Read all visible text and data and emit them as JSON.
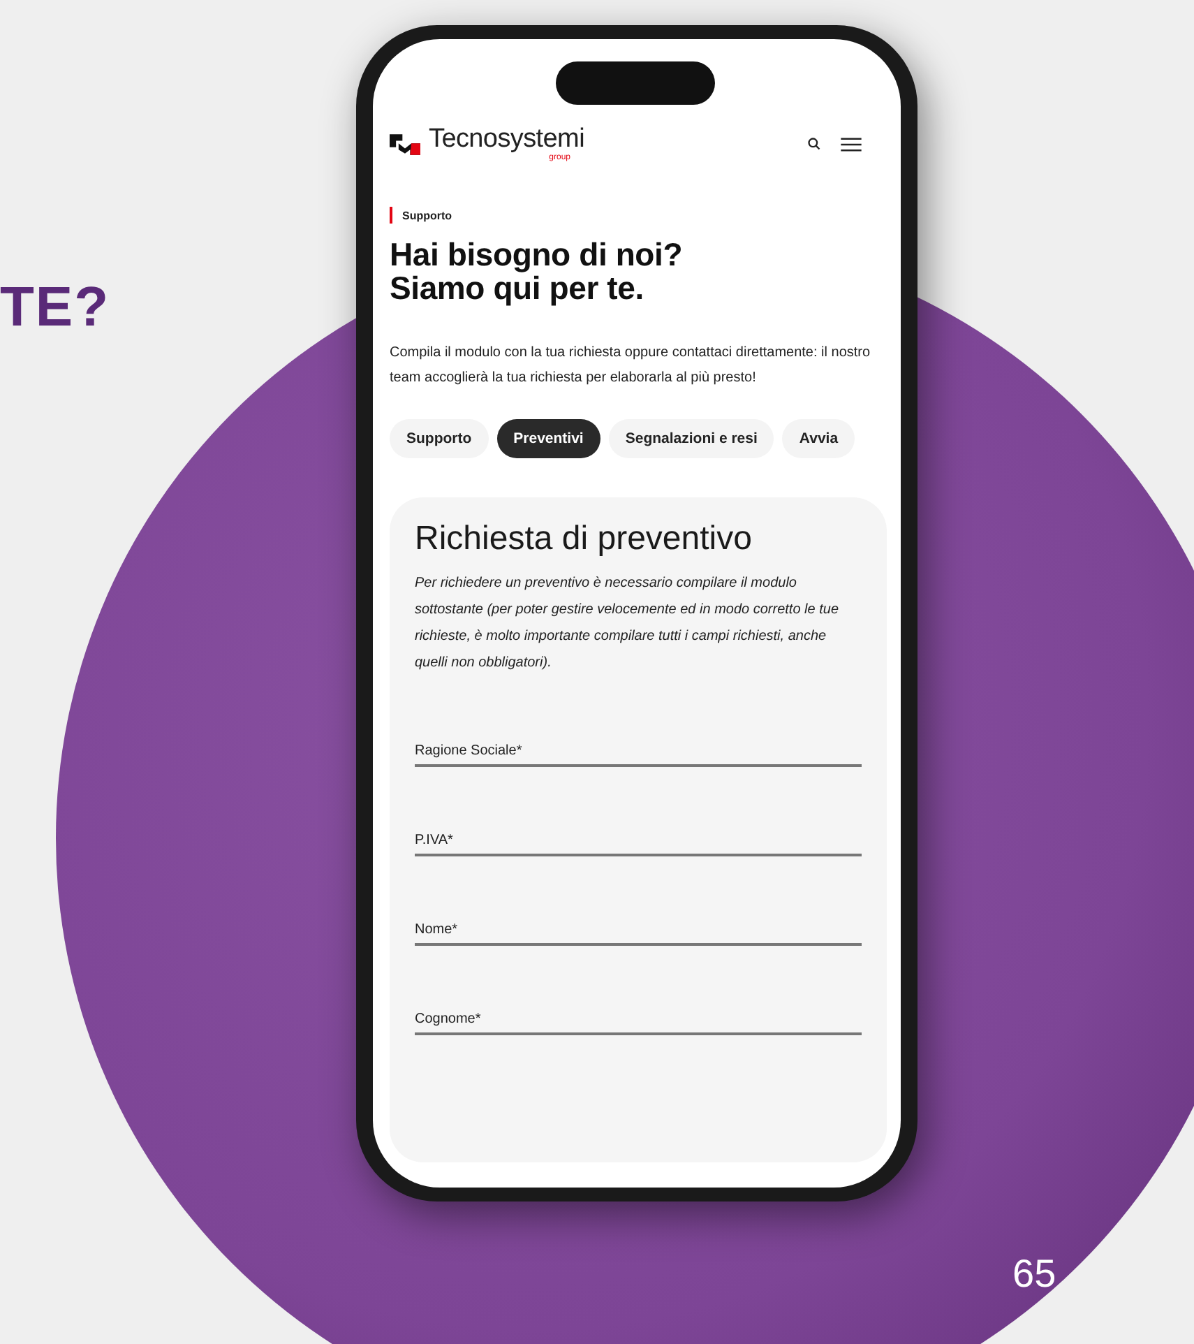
{
  "page": {
    "heading_fragment": "TE?",
    "page_number": "65"
  },
  "site_header": {
    "logo_text": "Tecnosystemi",
    "logo_subtext": "group"
  },
  "breadcrumb": "Supporto",
  "headline": "Hai bisogno di noi?\nSiamo qui per te.",
  "intro": "Compila il modulo con la tua richiesta oppure contattaci direttamente: il nostro team accoglierà la tua richiesta per elaborarla al più presto!",
  "tabs": [
    {
      "label": "Supporto",
      "selected": false
    },
    {
      "label": "Preventivi",
      "selected": true
    },
    {
      "label": "Segnalazioni e resi",
      "selected": false
    },
    {
      "label": "Avvia",
      "selected": false
    }
  ],
  "form": {
    "title": "Richiesta di preventivo",
    "description": "Per richiedere un preventivo è necessario compilare il modulo sottostante (per poter gestire velocemente ed in modo corretto le tue richieste, è molto importante compilare tutti i campi richiesti, anche quelli non obbligatori).",
    "fields": [
      {
        "placeholder": "Ragione Sociale*"
      },
      {
        "placeholder": "P.IVA*"
      },
      {
        "placeholder": "Nome*"
      },
      {
        "placeholder": "Cognome*"
      }
    ]
  }
}
